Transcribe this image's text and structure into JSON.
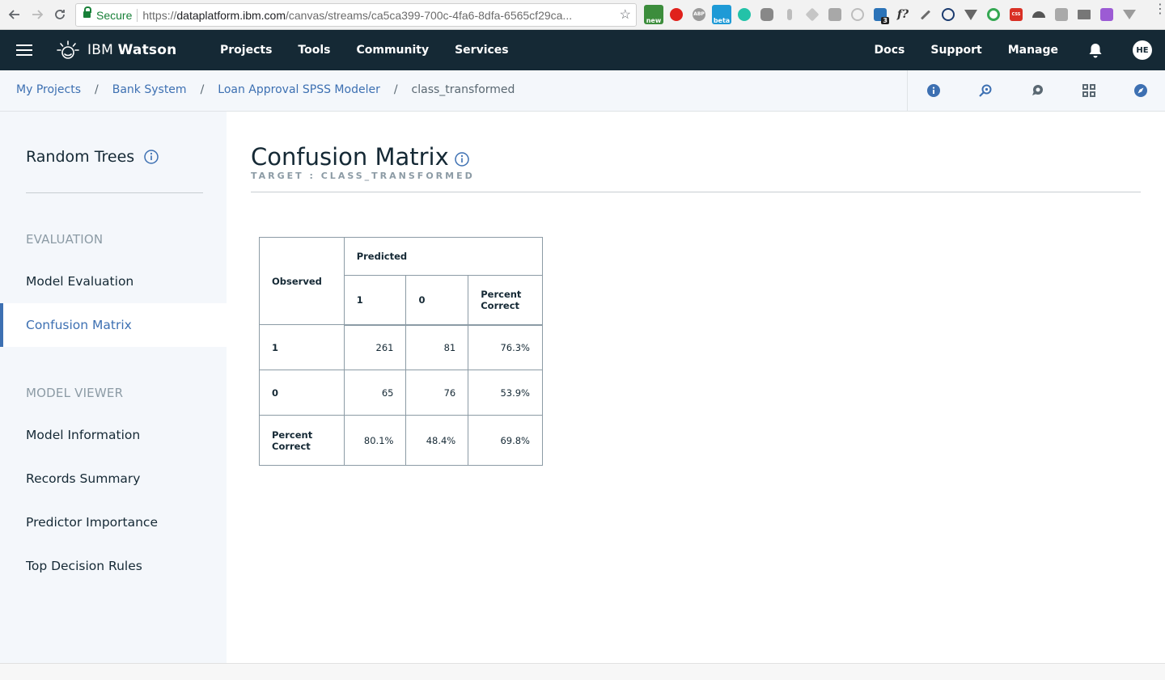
{
  "browser": {
    "secure_label": "Secure",
    "url_prefix": "https://",
    "url_host": "dataplatform.ibm.com",
    "url_path": "/canvas/streams/ca5ca399-700c-4fa6-8dfa-6565cf29ca...",
    "extensions": [
      "new-badge-extension",
      "opera-extension",
      "adblock-extension",
      "beta-badge-extension",
      "mercury-extension",
      "openai-extension",
      "pin-extension",
      "kite-extension",
      "k-extension",
      "circle-extension",
      "react-devtools-extension",
      "formula-extension",
      "pen-extension",
      "atom-extension",
      "vue-extension",
      "target-extension",
      "css-extension",
      "hat-extension",
      "square-extension",
      "monitor-extension",
      "puzzle-extension",
      "w-extension"
    ],
    "badges": {
      "new": "new",
      "beta": "beta",
      "abp": "ABP",
      "count": "3",
      "css": "CSS",
      "formula": "f?"
    }
  },
  "header": {
    "brand_prefix": "IBM",
    "brand_name": "Watson",
    "nav": [
      "Projects",
      "Tools",
      "Community",
      "Services"
    ],
    "right_nav": [
      "Docs",
      "Support",
      "Manage"
    ],
    "avatar_initials": "HE",
    "colors": {
      "bar": "#152935",
      "accent": "#3d70b2"
    }
  },
  "breadcrumb": {
    "items": [
      "My Projects",
      "Bank System",
      "Loan Approval SPSS Modeler"
    ],
    "current": "class_transformed",
    "separator": "/"
  },
  "sidebar": {
    "model_title": "Random Trees",
    "sections": [
      {
        "label": "EVALUATION",
        "items": [
          "Model Evaluation",
          "Confusion Matrix"
        ]
      },
      {
        "label": "MODEL VIEWER",
        "items": [
          "Model Information",
          "Records Summary",
          "Predictor Importance",
          "Top Decision Rules"
        ]
      }
    ],
    "active_item": "Confusion Matrix"
  },
  "main": {
    "title": "Confusion Matrix",
    "subtitle": "TARGET : CLASS_TRANSFORMED",
    "matrix": {
      "observed_label": "Observed",
      "predicted_label": "Predicted",
      "columns": [
        "1",
        "0",
        "Percent Correct"
      ],
      "rows": [
        {
          "label": "1",
          "cells": [
            "261",
            "81",
            "76.3%"
          ]
        },
        {
          "label": "0",
          "cells": [
            "65",
            "76",
            "53.9%"
          ]
        },
        {
          "label": "Percent Correct",
          "cells": [
            "80.1%",
            "48.4%",
            "69.8%"
          ]
        }
      ]
    }
  }
}
